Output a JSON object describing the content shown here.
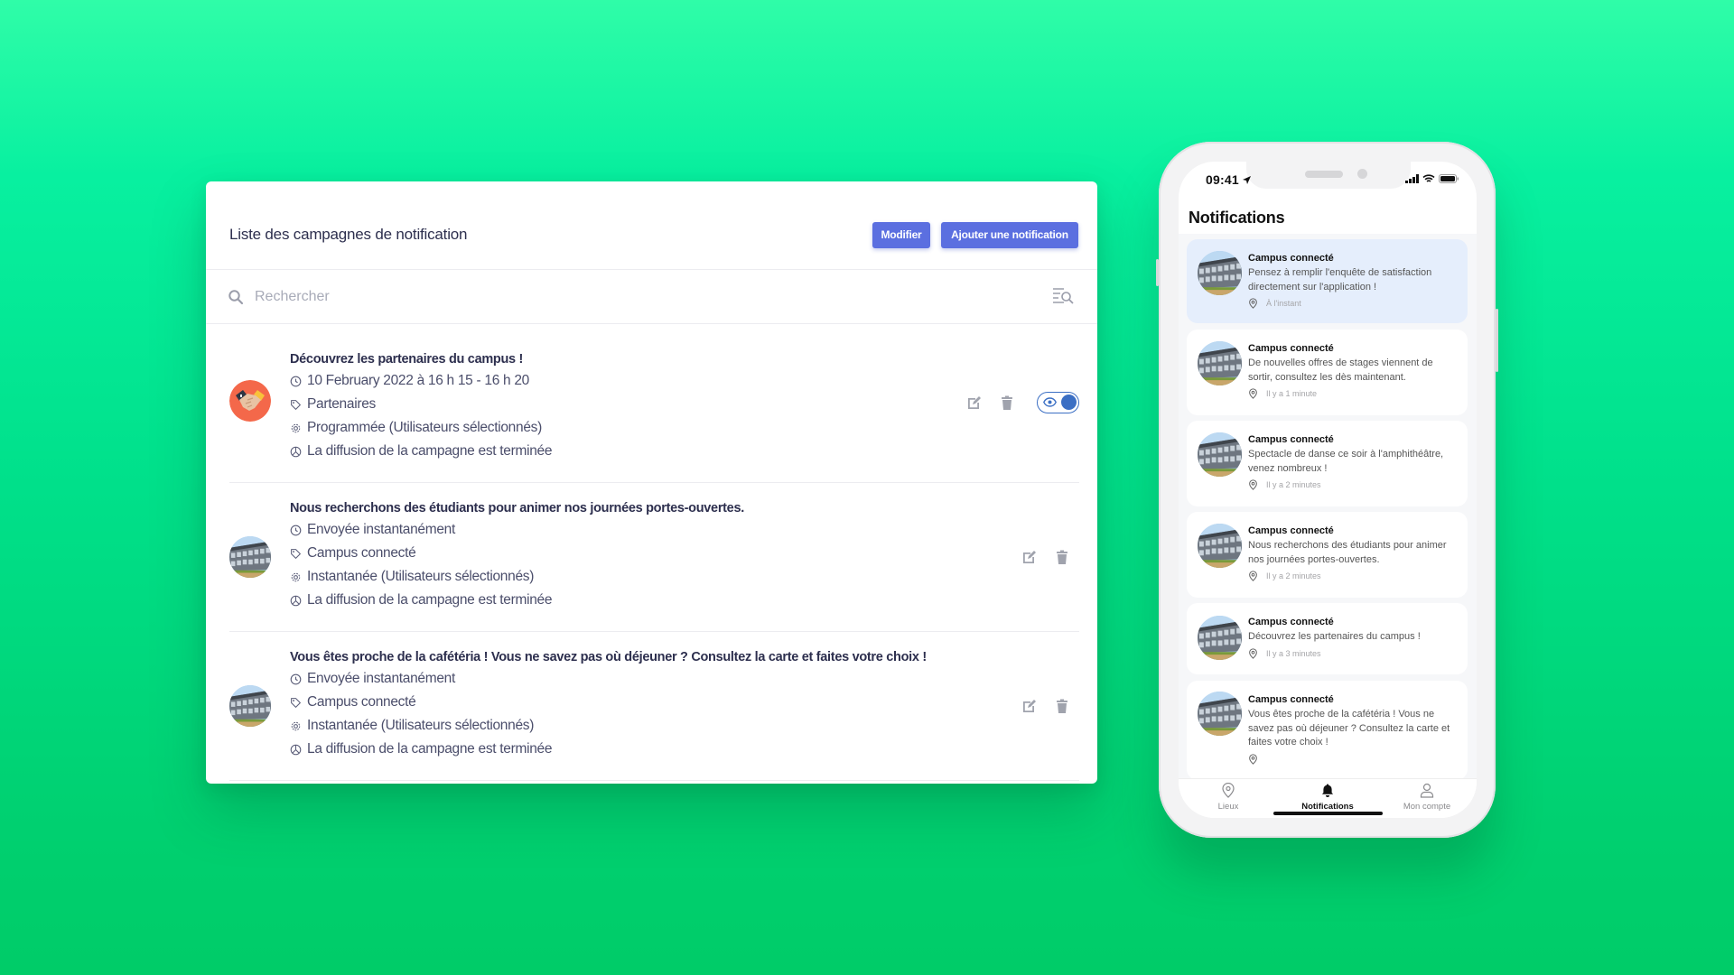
{
  "admin": {
    "title": "Liste des campagnes de notification",
    "buttons": {
      "modify": "Modifier",
      "add": "Ajouter une notification"
    },
    "search": {
      "placeholder": "Rechercher",
      "value": ""
    },
    "accent_color": "#5b6fe0",
    "campaigns": [
      {
        "title": "Découvrez les partenaires du campus !",
        "schedule": "10 February 2022 à 16 h 15 - 16 h 20",
        "tag": "Partenaires",
        "type": "Programmée (Utilisateurs sélectionnés)",
        "status": "La diffusion de la campagne est terminée",
        "avatar": "handshake",
        "visible_toggle": true
      },
      {
        "title": "Nous recherchons des étudiants pour animer nos journées portes-ouvertes.",
        "schedule": "Envoyée instantanément",
        "tag": "Campus connecté",
        "type": "Instantanée (Utilisateurs sélectionnés)",
        "status": "La diffusion de la campagne est terminée",
        "avatar": "campus-building",
        "visible_toggle": false
      },
      {
        "title": "Vous êtes proche de la cafétéria ! Vous ne savez pas où déjeuner ? Consultez la carte et faites votre choix !",
        "schedule": "Envoyée instantanément",
        "tag": "Campus connecté",
        "type": "Instantanée (Utilisateurs sélectionnés)",
        "status": "La diffusion de la campagne est terminée",
        "avatar": "campus-building",
        "visible_toggle": false
      }
    ]
  },
  "phone": {
    "status_time": "09:41",
    "title": "Notifications",
    "notifications": [
      {
        "sender": "Campus connecté",
        "text": "Pensez à remplir l'enquête de satisfaction directement sur l'application !",
        "time": "À l'instant",
        "highlighted": true
      },
      {
        "sender": "Campus connecté",
        "text": "De nouvelles offres de stages viennent de sortir, consultez les dès maintenant.",
        "time": "Il y a 1 minute",
        "highlighted": false
      },
      {
        "sender": "Campus connecté",
        "text": "Spectacle de danse ce soir à l'amphithéâtre, venez nombreux !",
        "time": "Il y a 2 minutes",
        "highlighted": false
      },
      {
        "sender": "Campus connecté",
        "text": "Nous recherchons des étudiants pour animer nos journées portes-ouvertes.",
        "time": "Il y a 2 minutes",
        "highlighted": false
      },
      {
        "sender": "Campus connecté",
        "text": "Découvrez les partenaires du campus !",
        "time": "Il y a 3 minutes",
        "highlighted": false
      },
      {
        "sender": "Campus connecté",
        "text": "Vous êtes proche de la cafétéria ! Vous ne savez pas où déjeuner ? Consultez la carte et faites votre choix !",
        "time": "",
        "highlighted": false
      }
    ],
    "tabs": [
      {
        "label": "Lieux",
        "icon": "map-pin-icon",
        "active": false
      },
      {
        "label": "Notifications",
        "icon": "bell-icon",
        "active": true
      },
      {
        "label": "Mon compte",
        "icon": "user-icon",
        "active": false
      }
    ]
  }
}
